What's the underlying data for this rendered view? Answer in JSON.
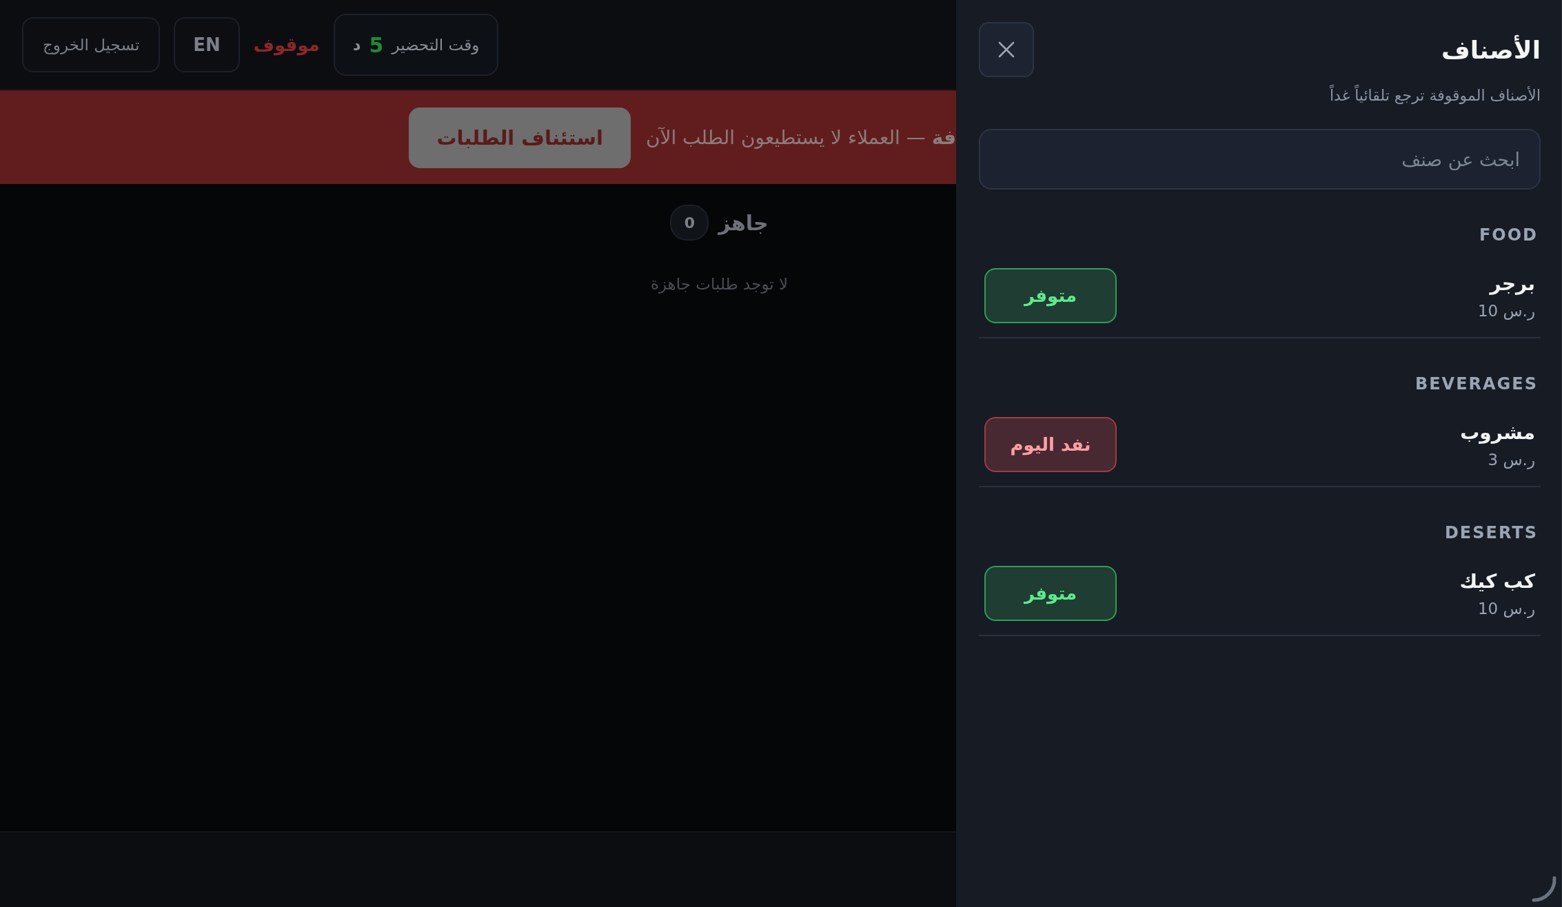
{
  "header": {
    "prep_time": {
      "label": "وقت التحضير",
      "value": "5",
      "unit": "د"
    },
    "status": "موقوف",
    "language_button": "EN",
    "logout_button": "تسجيل الخروج"
  },
  "banner": {
    "message": "**فة** — العملاء لا يستطيعون الطلب الآن",
    "resume_button": "استئناف الطلبات"
  },
  "ready_section": {
    "title": "جاهز",
    "count": "0",
    "empty_text": "لا توجد طلبات جاهزة"
  },
  "drawer": {
    "title": "الأصناف",
    "subtitle": "الأصناف الموقوفة ترجع تلقائياً غداً",
    "search": {
      "placeholder": "ابحث عن صنف"
    },
    "categories": [
      {
        "name": "FOOD",
        "items": [
          {
            "name": "برجر",
            "price": "ر.س 10",
            "available": true,
            "status_label": "متوفر"
          }
        ]
      },
      {
        "name": "BEVERAGES",
        "items": [
          {
            "name": "مشروب",
            "price": "ر.س 3",
            "available": false,
            "status_label": "نفد اليوم"
          }
        ]
      },
      {
        "name": "DESERTS",
        "items": [
          {
            "name": "كب كيك",
            "price": "ر.س 10",
            "available": true,
            "status_label": "متوفر"
          }
        ]
      }
    ]
  },
  "loading": true
}
